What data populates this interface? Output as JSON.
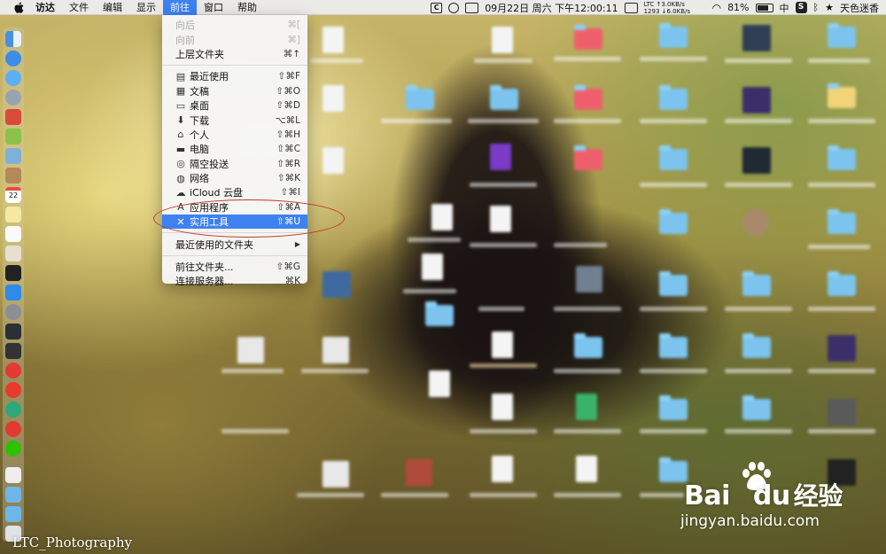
{
  "menubar": {
    "app_name": "访达",
    "items": [
      "文件",
      "编辑",
      "显示",
      "前往",
      "窗口",
      "帮助"
    ],
    "active_item": "前往",
    "status": {
      "net_up": "LTC ↑3.0KB/s",
      "net_down": "1293 ↓6.0KB/s",
      "datetime": "09月22日 周六 下午12:00:11",
      "battery": "81%",
      "battery_level": 0.81,
      "input_method": "中",
      "user_name": "天色迷香"
    }
  },
  "go_menu": {
    "back": {
      "label": "向后",
      "shortcut": "⌘["
    },
    "forward": {
      "label": "向前",
      "shortcut": "⌘]"
    },
    "enclosing": {
      "label": "上层文件夹",
      "shortcut": "⌘↑"
    },
    "recents": {
      "label": "最近使用",
      "shortcut": "⇧⌘F"
    },
    "documents": {
      "label": "文稿",
      "shortcut": "⇧⌘O"
    },
    "desktop": {
      "label": "桌面",
      "shortcut": "⇧⌘D"
    },
    "downloads": {
      "label": "下载",
      "shortcut": "⌥⌘L"
    },
    "home": {
      "label": "个人",
      "shortcut": "⇧⌘H"
    },
    "computer": {
      "label": "电脑",
      "shortcut": "⇧⌘C"
    },
    "airdrop": {
      "label": "隔空投送",
      "shortcut": "⇧⌘R"
    },
    "network": {
      "label": "网络",
      "shortcut": "⇧⌘K"
    },
    "icloud": {
      "label": "iCloud 云盘",
      "shortcut": "⇧⌘I"
    },
    "applications": {
      "label": "应用程序",
      "shortcut": "⇧⌘A"
    },
    "utilities": {
      "label": "实用工具",
      "shortcut": "⇧⌘U"
    },
    "recent_folders": {
      "label": "最近使用的文件夹",
      "shortcut": "▶"
    },
    "goto_folder": {
      "label": "前往文件夹...",
      "shortcut": "⇧⌘G"
    },
    "connect_server": {
      "label": "连接服务器...",
      "shortcut": "⌘K"
    }
  },
  "watermarks": {
    "photo_credit": "LTC_Photography",
    "baidu_brand": "Bai",
    "baidu_brand_2": "du",
    "baidu_cn": "经验",
    "baidu_url": "jingyan.baidu.com"
  },
  "colors": {
    "highlight": "#3d82f0",
    "annotation": "#c0392b"
  }
}
